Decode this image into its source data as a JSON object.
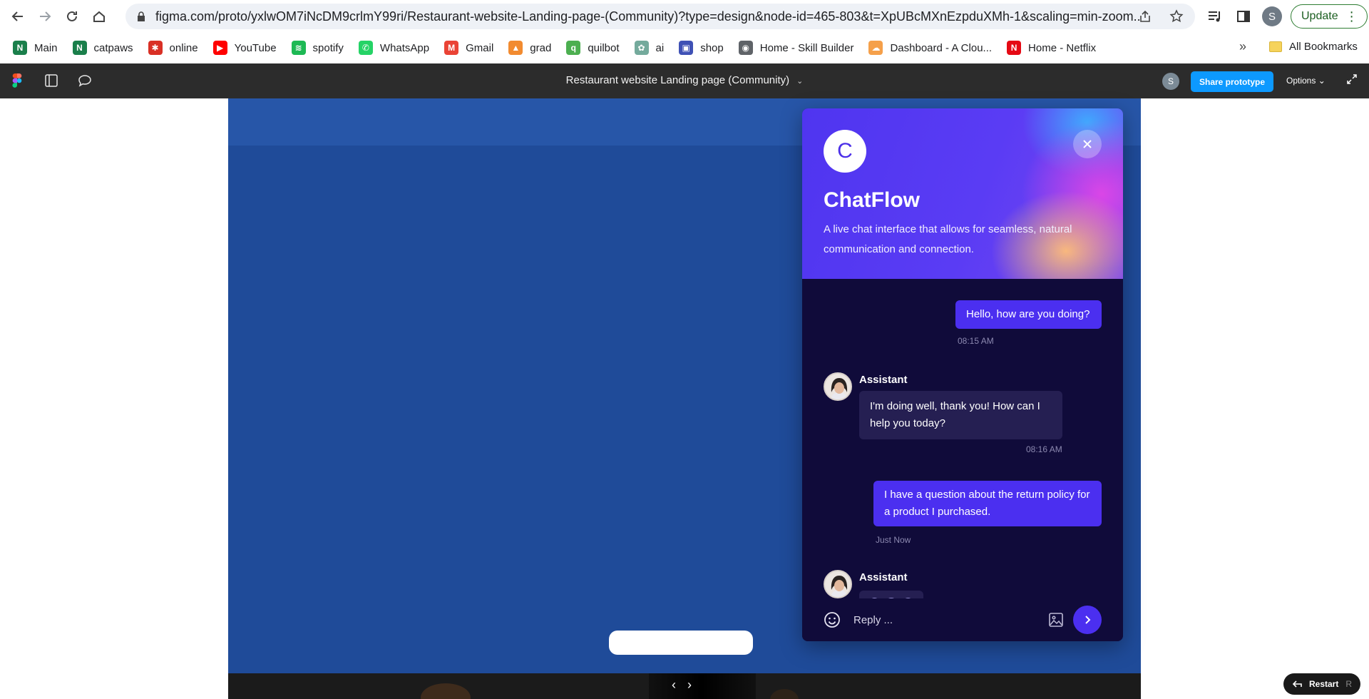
{
  "browser": {
    "url": "figma.com/proto/yxlwOM7iNcDM9crlmY99ri/Restaurant-website-Landing-page-(Community)?type=design&node-id=465-803&t=XpUBcMXnEzpduXMh-1&scaling=min-zoom...",
    "profile_initial": "S",
    "update_label": "Update",
    "bookmarks": [
      {
        "label": "Main",
        "icon": "notion-n-icon",
        "color": "#1a7f4b"
      },
      {
        "label": "catpaws",
        "icon": "notion-n-icon",
        "color": "#1a7f4b"
      },
      {
        "label": "online",
        "icon": "online-icon",
        "color": "#d93025"
      },
      {
        "label": "YouTube",
        "icon": "youtube-icon",
        "color": "#ff0000"
      },
      {
        "label": "spotify",
        "icon": "spotify-icon",
        "color": "#1db954"
      },
      {
        "label": "WhatsApp",
        "icon": "whatsapp-icon",
        "color": "#25d366"
      },
      {
        "label": "Gmail",
        "icon": "gmail-icon",
        "color": "#ea4335"
      },
      {
        "label": "grad",
        "icon": "grad-icon",
        "color": "#f28b30"
      },
      {
        "label": "quilbot",
        "icon": "quillbot-icon",
        "color": "#4caf50"
      },
      {
        "label": "ai",
        "icon": "chatgpt-icon",
        "color": "#74aa9c"
      },
      {
        "label": "shop",
        "icon": "shop-icon",
        "color": "#3f51b5"
      },
      {
        "label": "Home - Skill Builder",
        "icon": "globe-icon",
        "color": "#5f6368"
      },
      {
        "label": "Dashboard - A Clou...",
        "icon": "cloud-icon",
        "color": "#f5a04a"
      },
      {
        "label": "Home - Netflix",
        "icon": "netflix-icon",
        "color": "#e50914"
      }
    ],
    "more_label": "»",
    "all_bookmarks_label": "All Bookmarks"
  },
  "figma": {
    "document_title": "Restaurant website Landing page (Community)",
    "user_initial": "S",
    "share_label": "Share prototype",
    "options_label": "Options",
    "restart_label": "Restart",
    "restart_key": "R"
  },
  "chat": {
    "brand_initial": "C",
    "title": "ChatFlow",
    "subtitle": "A live chat interface that allows for seamless, natural communication and connection.",
    "messages": [
      {
        "from": "user",
        "text": "Hello, how are you doing?",
        "time": "08:15 AM"
      },
      {
        "from": "assistant",
        "name": "Assistant",
        "text": "I'm doing well, thank you! How can I help you today?",
        "time": "08:16 AM"
      },
      {
        "from": "user",
        "text": "I have a question about the return policy for a product I purchased.",
        "time": "Just Now"
      },
      {
        "from": "assistant",
        "name": "Assistant",
        "typing": true
      }
    ],
    "reply_placeholder": "Reply ...",
    "accent": "#4b2ff0",
    "background": "#100b3a"
  }
}
